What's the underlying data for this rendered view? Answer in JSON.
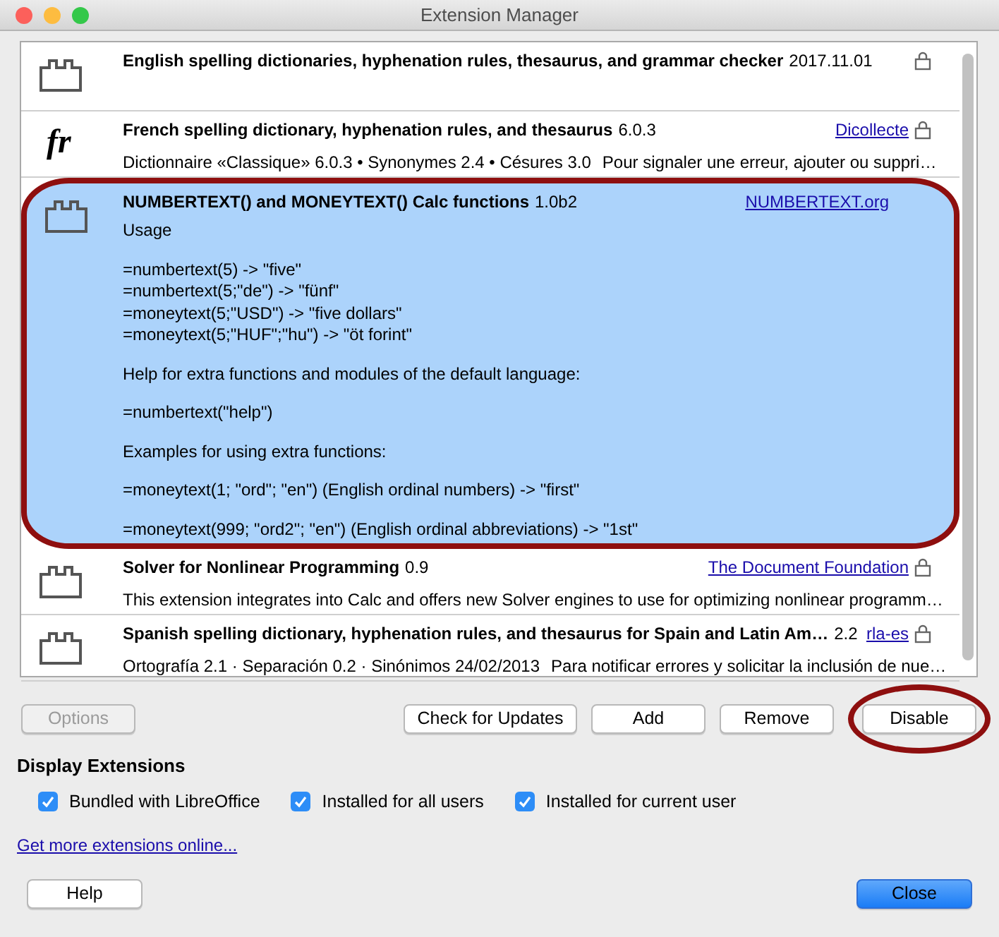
{
  "window": {
    "title": "Extension Manager"
  },
  "extensions": [
    {
      "kind": "brick",
      "title": "English spelling dictionaries, hyphenation rules, thesaurus, and grammar checker",
      "version": "2017.11.01",
      "locked": true,
      "selected": false,
      "circled": false
    },
    {
      "kind": "fr",
      "title": "French spelling dictionary, hyphenation rules, and thesaurus",
      "version": "6.0.3",
      "publisher": "Dicollecte",
      "description": [
        "Dictionnaire «Classique» 6.0.3 • Synonymes 2.4 • Césures 3.0",
        "Pour signaler une erreur, ajouter ou suppri…"
      ],
      "locked": true,
      "selected": false,
      "circled": false
    },
    {
      "kind": "brick",
      "title": "NUMBERTEXT() and MONEYTEXT() Calc functions",
      "version": "1.0b2",
      "publisher": "NUMBERTEXT.org",
      "paragraphs": [
        [
          "Usage"
        ],
        [
          "=numbertext(5) -> \"five\"",
          "=numbertext(5;\"de\") -> \"fünf\"",
          "=moneytext(5;\"USD\") -> \"five dollars\"",
          "=moneytext(5;\"HUF\";\"hu\") -> \"öt forint\""
        ],
        [
          "Help for extra functions and modules of the default language:"
        ],
        [
          "=numbertext(\"help\")"
        ],
        [
          "Examples for using extra functions:"
        ],
        [
          "=moneytext(1; \"ord\"; \"en\")  (English ordinal numbers) -> \"first\""
        ],
        [
          "=moneytext(999; \"ord2\"; \"en\")  (English ordinal abbreviations) -> \"1st\""
        ]
      ],
      "locked": false,
      "selected": true,
      "circled": true
    },
    {
      "kind": "brick",
      "title": "Solver for Nonlinear Programming",
      "version": "0.9",
      "publisher": "The Document Foundation",
      "description": [
        "This extension integrates into Calc and offers new Solver engines to use for optimizing nonlinear programm…"
      ],
      "locked": true,
      "selected": false,
      "circled": false
    },
    {
      "kind": "brick",
      "title": "Spanish spelling dictionary, hyphenation rules, and thesaurus for Spain and Latin Am…",
      "version": "2.2",
      "publisher": "rla-es",
      "description": [
        "Ortografía 2.1 · Separación 0.2 · Sinónimos 24/02/2013",
        "Para notificar errores y solicitar la inclusión de nue…"
      ],
      "locked": true,
      "selected": false,
      "circled": false
    }
  ],
  "actions": [
    {
      "label": "Options",
      "disabled": true,
      "circled": false
    },
    {
      "label": "Check for Updates",
      "disabled": false,
      "circled": false
    },
    {
      "label": "Add",
      "disabled": false,
      "circled": false
    },
    {
      "label": "Remove",
      "disabled": false,
      "circled": false
    },
    {
      "label": "Disable",
      "disabled": false,
      "circled": true
    }
  ],
  "display": {
    "heading": "Display Extensions",
    "options": [
      {
        "label": "Bundled with LibreOffice",
        "checked": true
      },
      {
        "label": "Installed for all users",
        "checked": true
      },
      {
        "label": "Installed for current user",
        "checked": true
      }
    ]
  },
  "link": "Get more extensions online...",
  "footer": [
    {
      "label": "Help",
      "default": false
    },
    {
      "label": "Close",
      "default": true
    }
  ]
}
